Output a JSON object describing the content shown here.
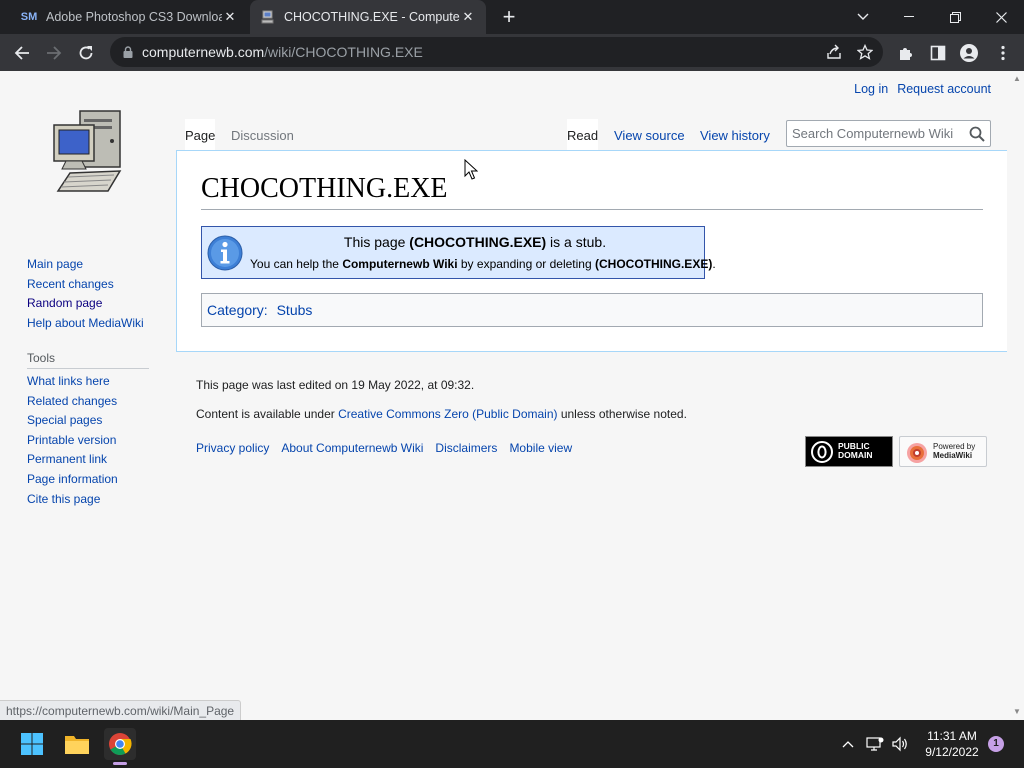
{
  "browser": {
    "tabs": [
      {
        "favicon": "SM",
        "title": "Adobe Photoshop CS3 Download"
      },
      {
        "favicon": "computernewb-icon",
        "title": "CHOCOTHING.EXE - Computernewb"
      }
    ],
    "url_host": "computernewb.com",
    "url_path": "/wiki/CHOCOTHING.EXE"
  },
  "wiki": {
    "personal": {
      "login": "Log in",
      "request": "Request account"
    },
    "tabs": {
      "page": "Page",
      "discussion": "Discussion",
      "read": "Read",
      "view_source": "View source",
      "view_history": "View history"
    },
    "search_placeholder": "Search Computernewb Wiki",
    "navigation": [
      "Main page",
      "Recent changes",
      "Random page",
      "Help about MediaWiki"
    ],
    "tools_heading": "Tools",
    "tools": [
      "What links here",
      "Related changes",
      "Special pages",
      "Printable version",
      "Permanent link",
      "Page information",
      "Cite this page"
    ],
    "title": "CHOCOTHING.EXE",
    "stub": {
      "l1_pre": "This page ",
      "l1_bold": "(CHOCOTHING.EXE)",
      "l1_post": " is a stub.",
      "l2_pre": "You can help the ",
      "l2_bold1": "Computernewb Wiki",
      "l2_mid": " by expanding or deleting ",
      "l2_bold2": "(CHOCOTHING.EXE)",
      "l2_post": "."
    },
    "category_label": "Category:",
    "category_value": "Stubs",
    "footer": {
      "last_edited": "This page was last edited on 19 May 2022, at 09:32.",
      "content_pre": "Content is available under ",
      "content_link": "Creative Commons Zero (Public Domain)",
      "content_post": " unless otherwise noted.",
      "places": [
        "Privacy policy",
        "About Computernewb Wiki",
        "Disclaimers",
        "Mobile view"
      ],
      "pd_badge": [
        "PUBLIC",
        "DOMAIN"
      ],
      "mw_badge": [
        "Powered by",
        "MediaWiki"
      ]
    }
  },
  "status_url": "https://computernewb.com/wiki/Main_Page",
  "taskbar": {
    "time": "11:31 AM",
    "date": "9/12/2022",
    "notifications": "1"
  },
  "colors": {
    "link": "#0645ad",
    "content_border": "#a7d7f9",
    "stub_bg": "#dbeaff",
    "stub_border": "#3355aa"
  }
}
